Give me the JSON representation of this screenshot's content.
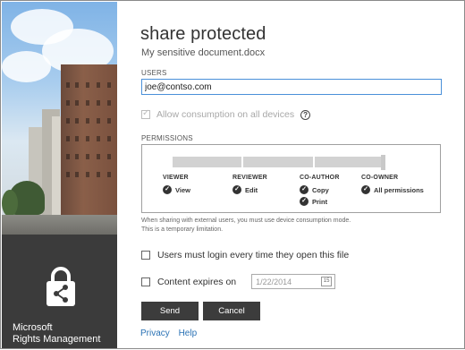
{
  "brand": {
    "line1": "Microsoft",
    "line2": "Rights Management",
    "logo_icon": "lock-share-icon"
  },
  "dialog": {
    "title": "share protected",
    "filename": "My sensitive document.docx"
  },
  "users": {
    "label": "USERS",
    "value": "joe@contso.com"
  },
  "allow_devices": {
    "label": "Allow consumption on all devices",
    "checked": true,
    "disabled": true,
    "help_icon": "question-circle-icon",
    "help_glyph": "?"
  },
  "permissions": {
    "label": "PERMISSIONS",
    "selected_level": "CO-OWNER",
    "levels": [
      {
        "name": "VIEWER",
        "items": [
          "View"
        ]
      },
      {
        "name": "REVIEWER",
        "items": [
          "Edit"
        ]
      },
      {
        "name": "CO-AUTHOR",
        "items": [
          "Copy",
          "Print"
        ]
      },
      {
        "name": "CO-OWNER",
        "items": [
          "All permissions"
        ]
      }
    ],
    "check_glyph": "✓"
  },
  "note": {
    "line1": "When sharing with external users, you must use device consumption mode.",
    "line2": "This is a temporary limitation."
  },
  "login_every_time": {
    "label": "Users must login every time they open this file",
    "checked": false
  },
  "expires": {
    "label": "Content expires on",
    "checked": false,
    "date_placeholder": "1/22/2014",
    "calendar_icon": "calendar-icon",
    "calendar_glyph": "15"
  },
  "buttons": {
    "send": "Send",
    "cancel": "Cancel"
  },
  "links": {
    "privacy": "Privacy",
    "help": "Help"
  }
}
